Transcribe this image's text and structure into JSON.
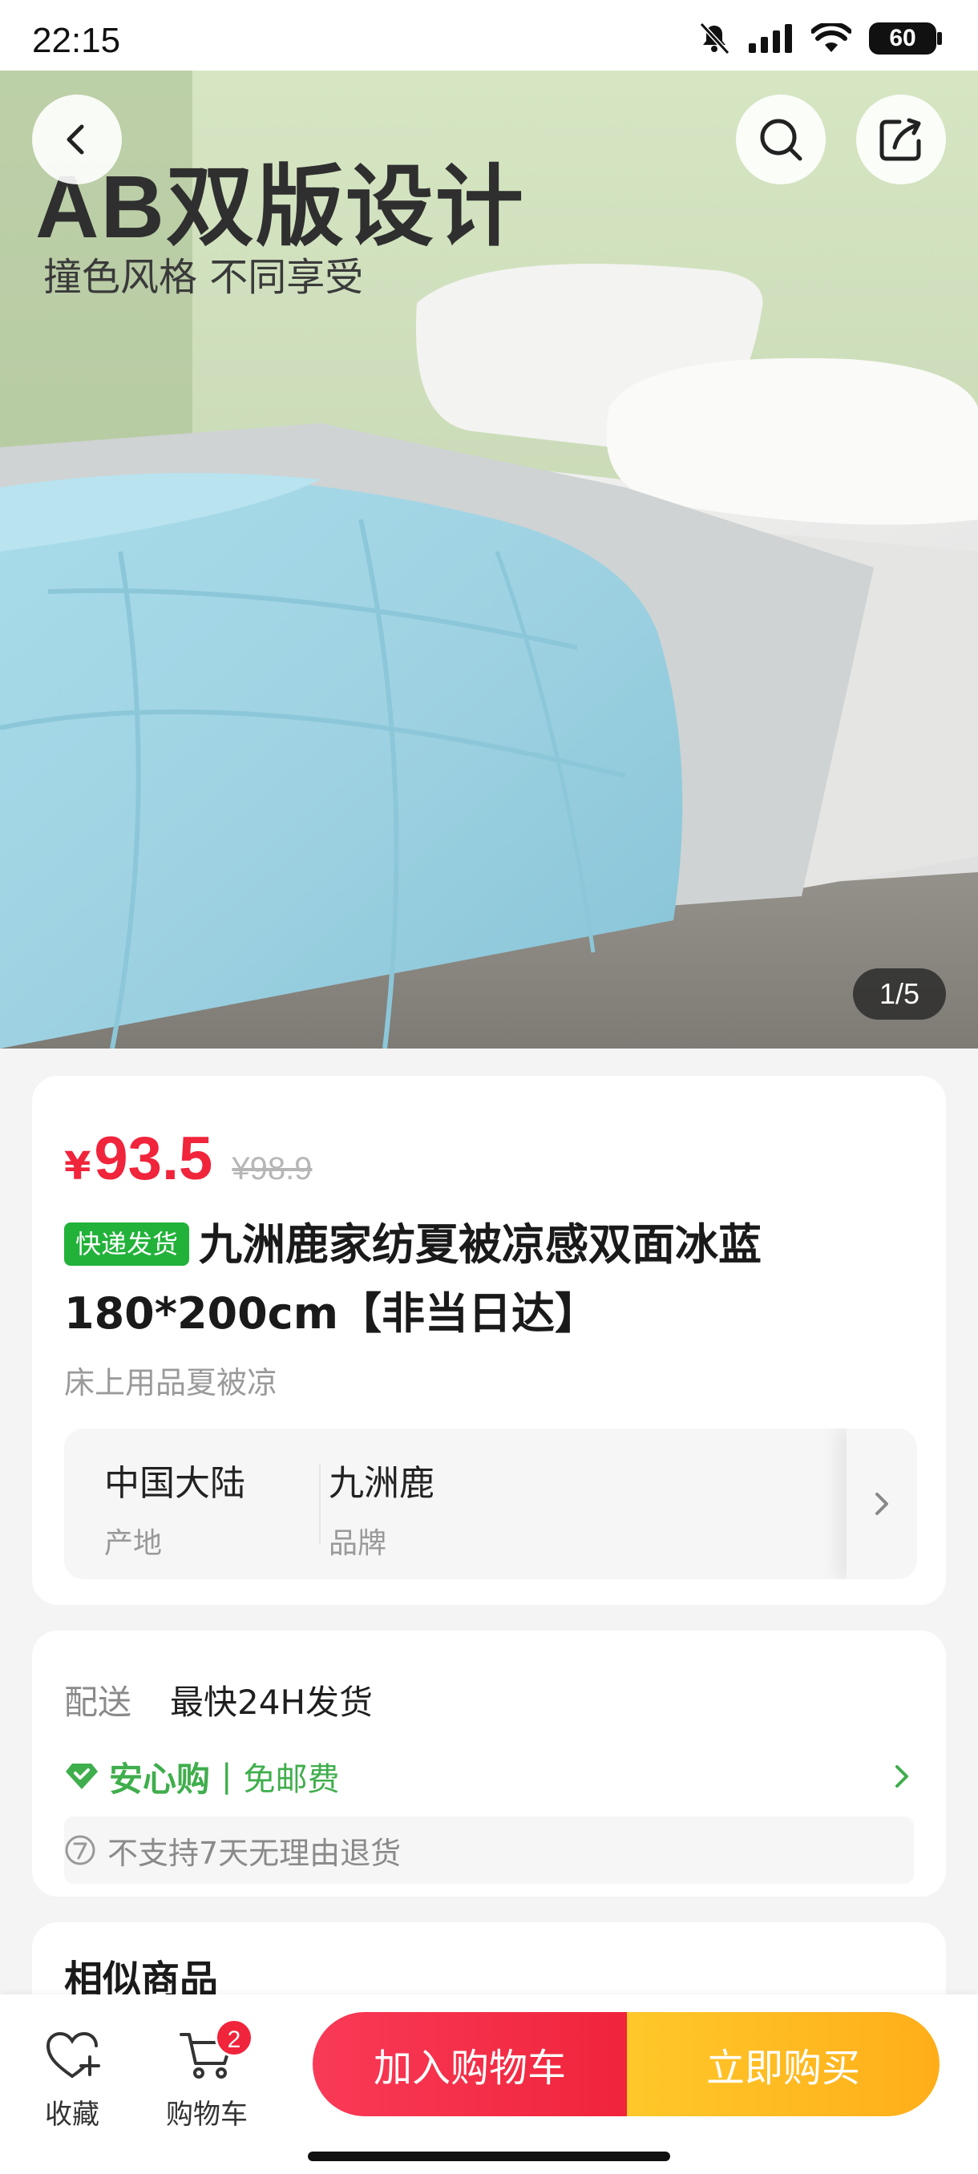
{
  "status_bar": {
    "time": "22:15",
    "battery": "60"
  },
  "hero": {
    "title": "AB双版设计",
    "subtitle": "撞色风格 不同享受",
    "counter": "1/5",
    "back_icon": "chevron-left-icon",
    "search_icon": "search-icon",
    "share_icon": "share-icon"
  },
  "product": {
    "currency": "¥",
    "price": "93.5",
    "original_price": "¥98.9",
    "badge": "快递发货",
    "title": "九洲鹿家纺夏被凉感双面冰蓝180*200cm【非当日达】",
    "category": "床上用品夏被凉",
    "attributes": [
      {
        "value": "中国大陆",
        "key": "产地"
      },
      {
        "value": "九洲鹿",
        "key": "品牌"
      }
    ]
  },
  "shipping": {
    "label": "配送",
    "value": "最快24H发货",
    "assurance_brand": "安心购",
    "assurance_sep": "|",
    "assurance_free": "免邮费",
    "return_policy": "不支持7天无理由退货"
  },
  "similar": {
    "title": "相似商品"
  },
  "bottom_bar": {
    "favorite_label": "收藏",
    "cart_label": "购物车",
    "cart_count": "2",
    "add_to_cart": "加入购物车",
    "buy_now": "立即购买"
  },
  "colors": {
    "accent_red": "#f0243b",
    "accent_yellow": "#ffae1a",
    "assure_green": "#3fae4c",
    "badge_green": "#22b23a"
  }
}
